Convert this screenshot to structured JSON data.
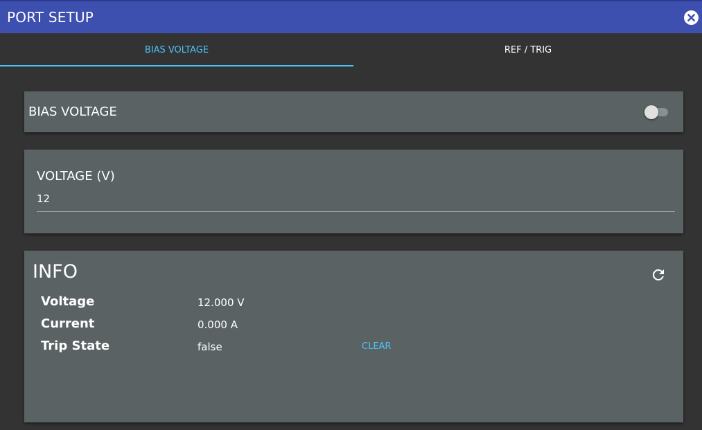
{
  "window": {
    "title": "PORT SETUP",
    "close_icon": "close-icon"
  },
  "tabs": [
    {
      "label": "BIAS VOLTAGE",
      "active": true
    },
    {
      "label": "REF / TRIG",
      "active": false
    }
  ],
  "bias_card": {
    "label": "BIAS VOLTAGE",
    "toggle_on": false
  },
  "voltage_card": {
    "label": "VOLTAGE (V)",
    "value": "12"
  },
  "info_card": {
    "title": "INFO",
    "refresh_icon": "refresh-icon",
    "rows": [
      {
        "key": "Voltage",
        "value": "12.000 V"
      },
      {
        "key": "Current",
        "value": "0.000 A"
      },
      {
        "key": "Trip State",
        "value": "false",
        "action": "CLEAR"
      }
    ]
  },
  "colors": {
    "titlebar": "#3d50b0",
    "accent": "#4fc3f7",
    "card": "#5a6263",
    "background": "#333333"
  }
}
